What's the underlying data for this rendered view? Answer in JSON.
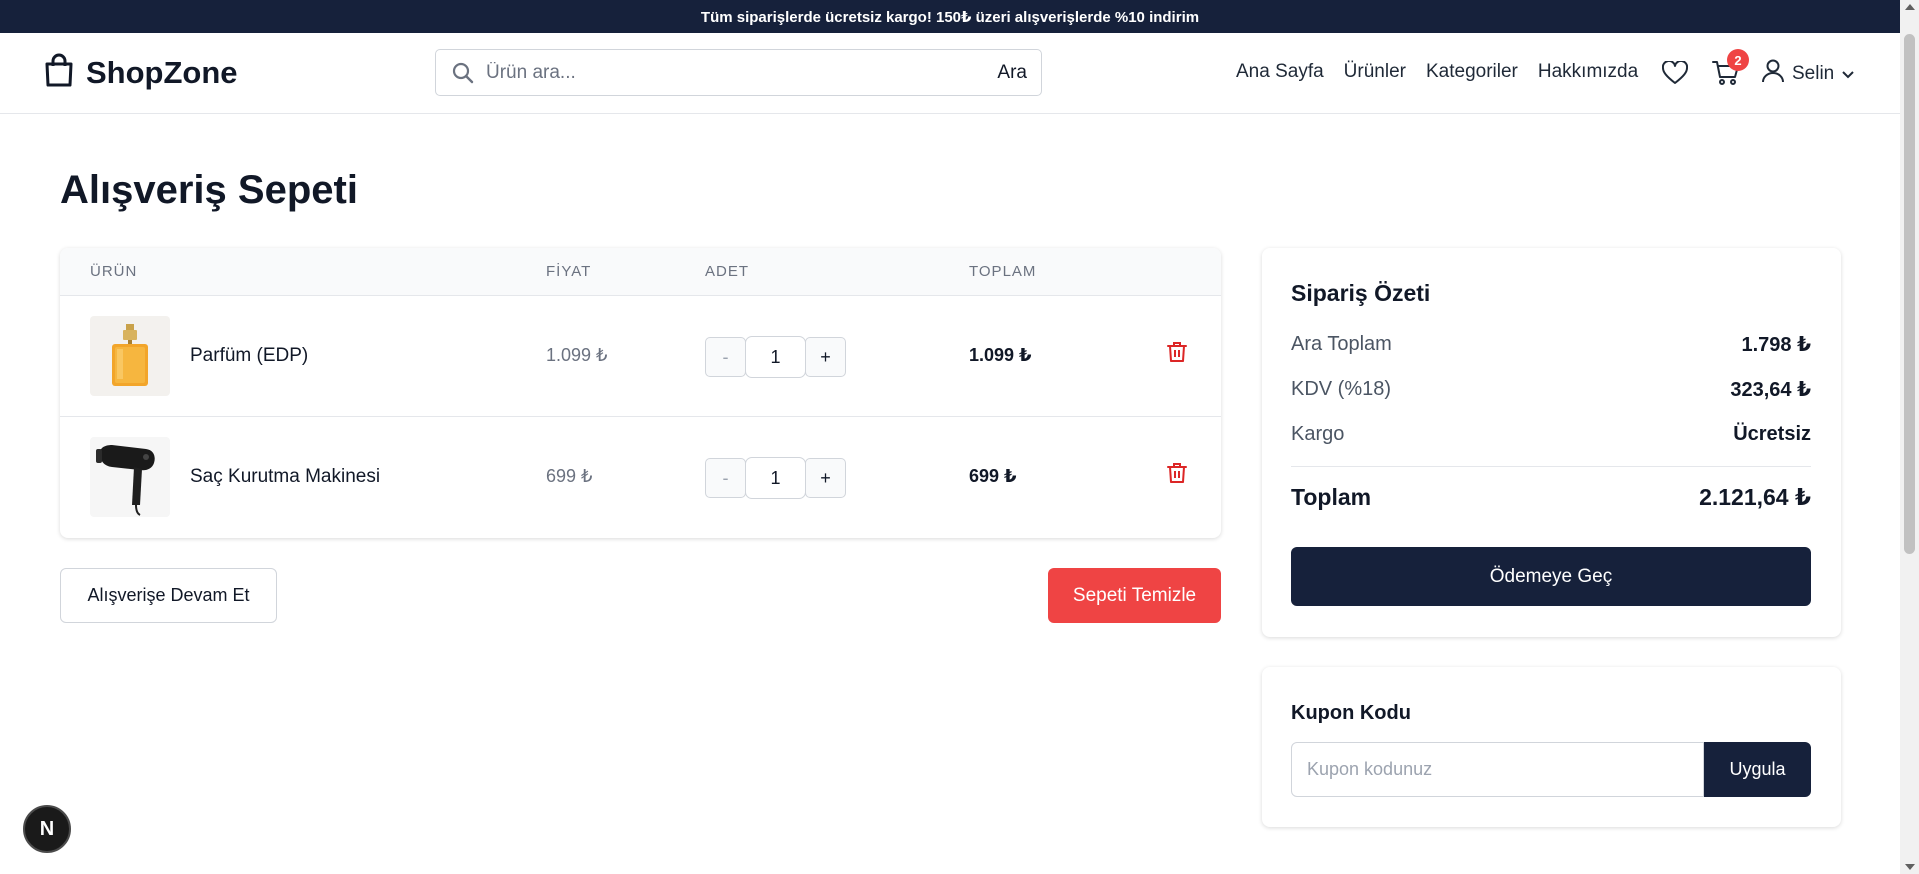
{
  "promo": {
    "text": "Tüm siparişlerde ücretsiz kargo! 150₺ üzeri alışverişlerde %10 indirim"
  },
  "header": {
    "logo": "ShopZone",
    "search": {
      "placeholder": "Ürün ara...",
      "value": "",
      "button": "Ara"
    },
    "nav": [
      "Ana Sayfa",
      "Ürünler",
      "Kategoriler",
      "Hakkımızda"
    ],
    "cart_count": "2",
    "user": "Selin",
    "icons": [
      "shopping-bag-icon",
      "search-icon",
      "heart-icon",
      "cart-icon",
      "user-icon",
      "chevron-down-icon"
    ]
  },
  "page": {
    "title": "Alışveriş Sepeti"
  },
  "cart": {
    "headers": {
      "product": "ÜRÜN",
      "price": "FİYAT",
      "qty": "ADET",
      "total": "TOPLAM"
    },
    "items": [
      {
        "name": "Parfüm (EDP)",
        "price": "1.099 ₺",
        "qty": "1",
        "total": "1.099 ₺",
        "minus": "-",
        "plus": "+"
      },
      {
        "name": "Saç Kurutma Makinesi",
        "price": "699 ₺",
        "qty": "1",
        "total": "699 ₺",
        "minus": "-",
        "plus": "+"
      }
    ],
    "continue_label": "Alışverişe Devam Et",
    "clear_label": "Sepeti Temizle"
  },
  "summary": {
    "title": "Sipariş Özeti",
    "subtotal_label": "Ara Toplam",
    "subtotal": "1.798 ₺",
    "tax_label": "KDV (%18)",
    "tax": "323,64 ₺",
    "shipping_label": "Kargo",
    "shipping": "Ücretsiz",
    "total_label": "Toplam",
    "total": "2.121,64 ₺",
    "checkout_label": "Ödemeye Geç"
  },
  "coupon": {
    "title": "Kupon Kodu",
    "placeholder": "Kupon kodunuz",
    "value": "",
    "button": "Uygula"
  },
  "dev_badge": "N",
  "colors": {
    "navy": "#16213b",
    "red": "#ef4444",
    "danger_icon": "#dc2626"
  }
}
